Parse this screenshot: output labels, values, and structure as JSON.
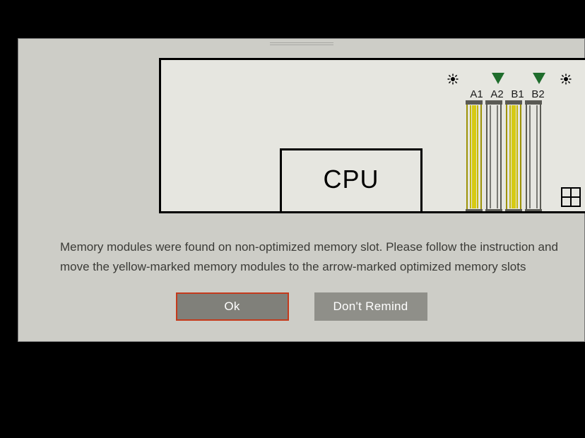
{
  "dialog": {
    "cpu_label": "CPU",
    "slot_labels": [
      "A1",
      "A2",
      "B1",
      "B2"
    ],
    "slots": [
      {
        "id": "A1",
        "filled": true,
        "arrow": false
      },
      {
        "id": "A2",
        "filled": false,
        "arrow": true
      },
      {
        "id": "B1",
        "filled": true,
        "arrow": false
      },
      {
        "id": "B2",
        "filled": false,
        "arrow": true
      }
    ],
    "message": "Memory modules were found on non-optimized memory slot. Please follow the instruction and move the yellow-marked memory modules to the arrow-marked optimized memory slots",
    "buttons": {
      "ok": "Ok",
      "dont_remind": "Don't Remind"
    }
  }
}
